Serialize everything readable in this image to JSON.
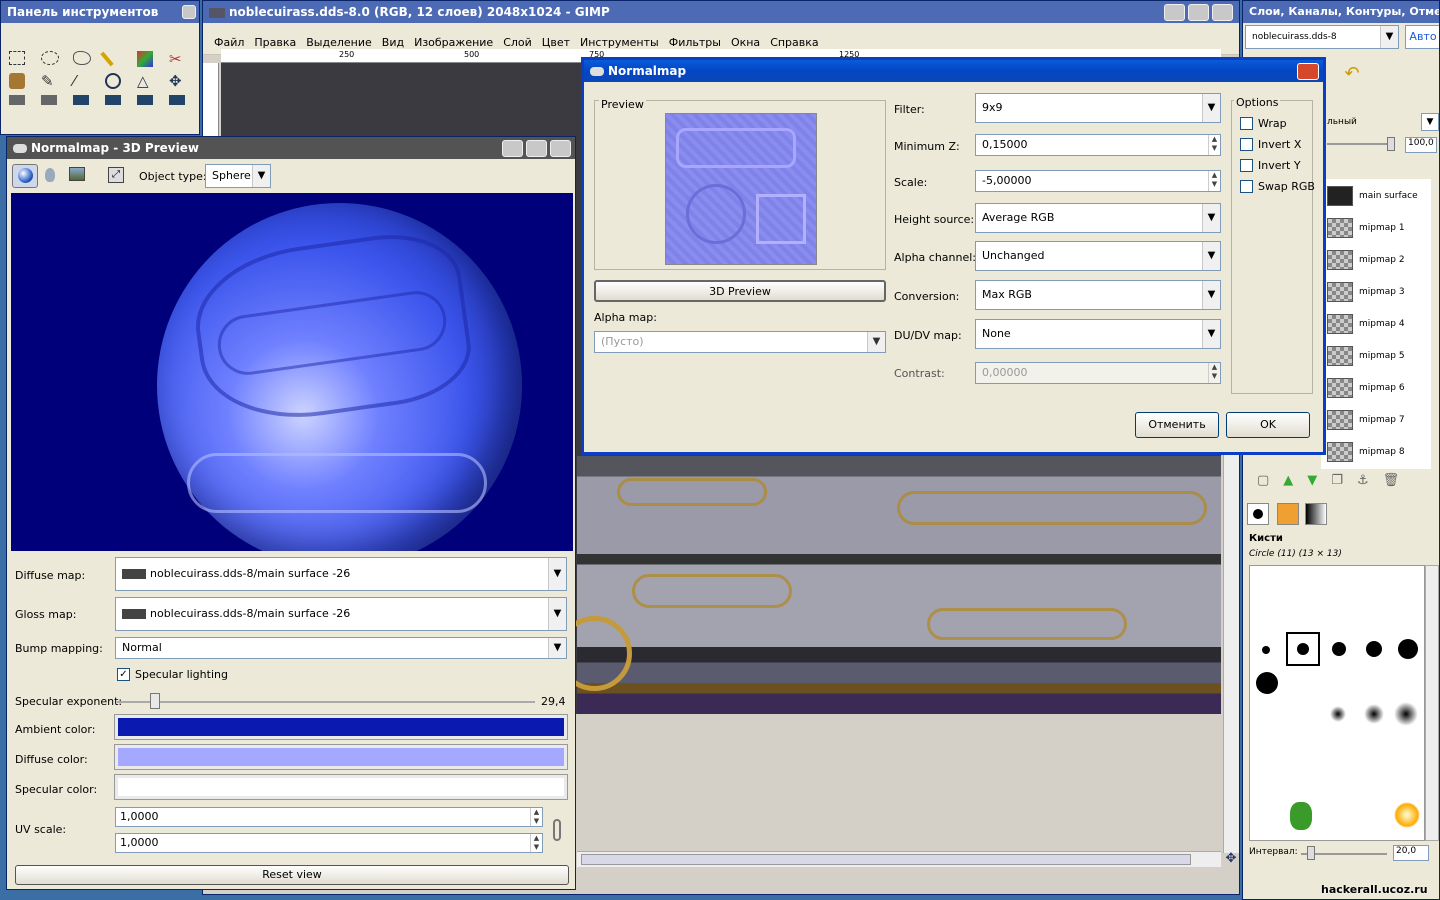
{
  "toolbox": {
    "title": "Панель инструментов"
  },
  "gimp": {
    "title": "noblecuirass.dds-8.0 (RGB, 12 слоев) 2048x1024 - GIMP",
    "menu": [
      "Файл",
      "Правка",
      "Выделение",
      "Вид",
      "Изображение",
      "Слой",
      "Цвет",
      "Инструменты",
      "Фильтры",
      "Окна",
      "Справка"
    ],
    "ruler": [
      "250",
      "500",
      "750",
      "1250"
    ]
  },
  "layers_panel": {
    "title": "Слои, Каналы, Контуры, Отме...",
    "image_select": "noblecuirass.dds-8",
    "auto_button": "Авто",
    "mode_label": "льный",
    "opacity_value": "100,0",
    "layers": [
      "main surface",
      "mipmap 1",
      "mipmap 2",
      "mipmap 3",
      "mipmap 4",
      "mipmap 5",
      "mipmap 6",
      "mipmap 7",
      "mipmap 8"
    ]
  },
  "brushes": {
    "title": "Кисти",
    "current": "Circle (11) (13 × 13)",
    "interval_label": "Интервал:",
    "interval_value": "20,0"
  },
  "watermark": "hackerall.ucoz.ru",
  "preview3d": {
    "title": "Normalmap - 3D Preview",
    "object_type_label": "Object type:",
    "object_type": "Sphere",
    "diffuse_label": "Diffuse map:",
    "diffuse_value": "noblecuirass.dds-8/main surface -26",
    "gloss_label": "Gloss map:",
    "gloss_value": "noblecuirass.dds-8/main surface -26",
    "bump_label": "Bump mapping:",
    "bump_value": "Normal",
    "specular_lighting": "Specular lighting",
    "spec_exp_label": "Specular exponent:",
    "spec_exp_value": "29,4",
    "spec_exp_level": 0.09,
    "ambient_label": "Ambient color:",
    "diffuse_color_label": "Diffuse color:",
    "specular_color_label": "Specular color:",
    "uv_label": "UV scale:",
    "uv1": "1,0000",
    "uv2": "1,0000",
    "reset": "Reset view",
    "colors": {
      "ambient": "#0a1ab0",
      "diffuse": "#a5a8ff",
      "specular": "#ffffff",
      "bg": "#00007a"
    }
  },
  "normalmap": {
    "title": "Normalmap",
    "preview_label": "Preview",
    "preview3d_button": "3D Preview",
    "alpha_map_label": "Alpha map:",
    "alpha_map_value": "(Пусто)",
    "filter_label": "Filter:",
    "filter_value": "9x9",
    "minz_label": "Minimum Z:",
    "minz_value": "0,15000",
    "scale_label": "Scale:",
    "scale_value": "-5,00000",
    "height_label": "Height source:",
    "height_value": "Average RGB",
    "alpha_label": "Alpha channel:",
    "alpha_value": "Unchanged",
    "conv_label": "Conversion:",
    "conv_value": "Max RGB",
    "dudv_label": "DU/DV map:",
    "dudv_value": "None",
    "contrast_label": "Contrast:",
    "contrast_value": "0,00000",
    "options_label": "Options",
    "options": [
      "Wrap",
      "Invert X",
      "Invert Y",
      "Swap RGB"
    ],
    "cancel": "Отменить",
    "ok": "OK"
  }
}
